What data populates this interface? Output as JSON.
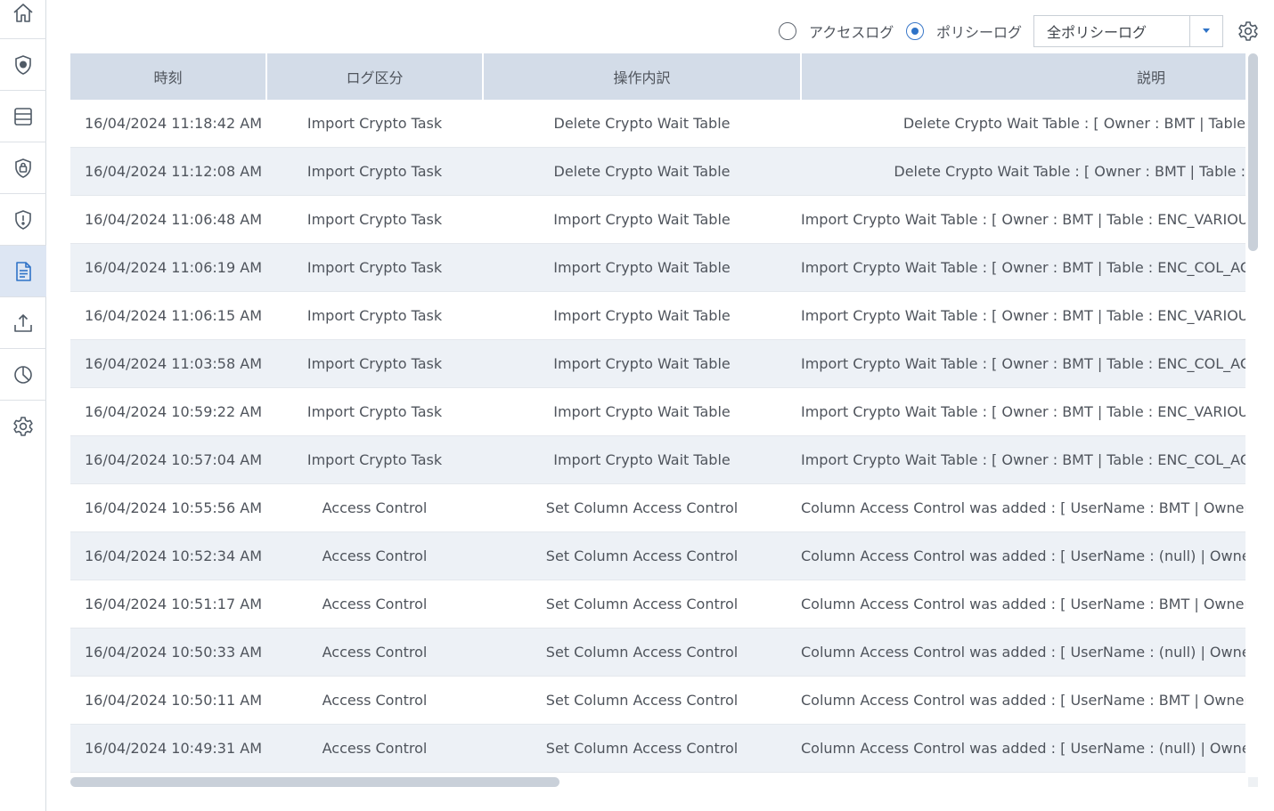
{
  "sidebar": {
    "items": [
      {
        "icon": "home-icon"
      },
      {
        "icon": "shield-badge-icon"
      },
      {
        "icon": "database-icon"
      },
      {
        "icon": "shield-lock-icon"
      },
      {
        "icon": "shield-alert-icon"
      },
      {
        "icon": "document-log-icon",
        "active": true
      },
      {
        "icon": "upload-icon"
      },
      {
        "icon": "pie-chart-icon"
      },
      {
        "icon": "gear-icon"
      }
    ]
  },
  "toolbar": {
    "radio_access_label": "アクセスログ",
    "radio_policy_label": "ポリシーログ",
    "selected_radio": "policy",
    "dropdown_value": "全ポリシーログ",
    "settings_icon": "gear-icon"
  },
  "table": {
    "headers": [
      "時刻",
      "ログ区分",
      "操作内訳",
      "説明"
    ],
    "rows": [
      [
        "16/04/2024 11:18:42 AM",
        "Import Crypto Task",
        "Delete Crypto Wait Table",
        "Delete Crypto Wait Table : [ Owner : BMT | Table"
      ],
      [
        "16/04/2024 11:12:08 AM",
        "Import Crypto Task",
        "Delete Crypto Wait Table",
        "Delete Crypto Wait Table : [ Owner : BMT | Table :"
      ],
      [
        "16/04/2024 11:06:48 AM",
        "Import Crypto Task",
        "Import Crypto Wait Table",
        "Import Crypto Wait Table : [ Owner : BMT | Table : ENC_VARIOUS |"
      ],
      [
        "16/04/2024 11:06:19 AM",
        "Import Crypto Task",
        "Import Crypto Wait Table",
        "Import Crypto Wait Table : [ Owner : BMT | Table : ENC_COL_ACCE"
      ],
      [
        "16/04/2024 11:06:15 AM",
        "Import Crypto Task",
        "Import Crypto Wait Table",
        "Import Crypto Wait Table : [ Owner : BMT | Table : ENC_VARIOUS"
      ],
      [
        "16/04/2024 11:03:58 AM",
        "Import Crypto Task",
        "Import Crypto Wait Table",
        "Import Crypto Wait Table : [ Owner : BMT | Table : ENC_COL_ACCE"
      ],
      [
        "16/04/2024 10:59:22 AM",
        "Import Crypto Task",
        "Import Crypto Wait Table",
        "Import Crypto Wait Table : [ Owner : BMT | Table : ENC_VARIOUS"
      ],
      [
        "16/04/2024 10:57:04 AM",
        "Import Crypto Task",
        "Import Crypto Wait Table",
        "Import Crypto Wait Table : [ Owner : BMT | Table : ENC_COL_ACCE"
      ],
      [
        "16/04/2024 10:55:56 AM",
        "Access Control",
        "Set Column Access Control",
        "Column Access Control was added : [ UserName : BMT | Owner : I"
      ],
      [
        "16/04/2024 10:52:34 AM",
        "Access Control",
        "Set Column Access Control",
        "Column Access Control was added : [ UserName : (null) | Owner : ("
      ],
      [
        "16/04/2024 10:51:17 AM",
        "Access Control",
        "Set Column Access Control",
        "Column Access Control was added : [ UserName : BMT | Owner : I"
      ],
      [
        "16/04/2024 10:50:33 AM",
        "Access Control",
        "Set Column Access Control",
        "Column Access Control was added : [ UserName : (null) | Owner : ("
      ],
      [
        "16/04/2024 10:50:11 AM",
        "Access Control",
        "Set Column Access Control",
        "Column Access Control was added : [ UserName : BMT | Owner : I"
      ],
      [
        "16/04/2024 10:49:31 AM",
        "Access Control",
        "Set Column Access Control",
        "Column Access Control was added : [ UserName : (null) | Owner : ("
      ]
    ]
  },
  "colors": {
    "accent": "#2f73c7",
    "header_bg": "#d3dce8",
    "row_alt_bg": "#edf1f6",
    "active_nav_bg": "#dde6f3"
  }
}
